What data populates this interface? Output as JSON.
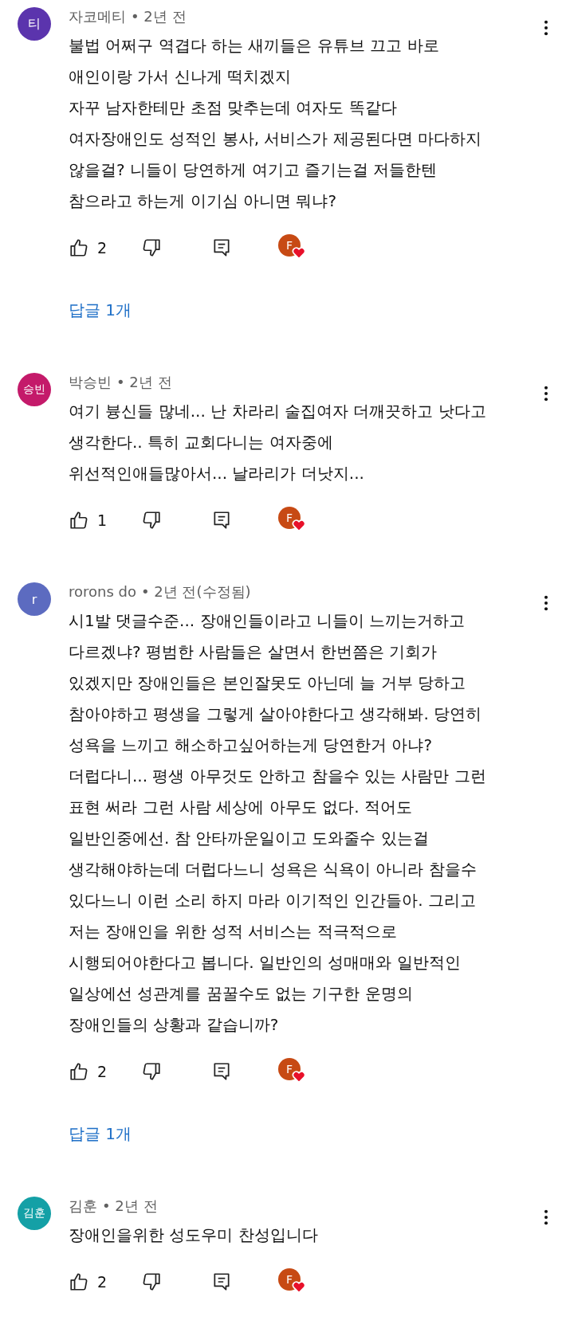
{
  "comments": [
    {
      "avatar": {
        "text": "티",
        "color": "#5b34ad"
      },
      "author": "자코메티",
      "age": "• 2년 전",
      "text": "불법 어쩌구 역겹다 하는 새끼들은 유튜브 끄고 바로\n애인이랑 가서 신나게 떡치겠지\n자꾸 남자한테만 초점 맞추는데 여자도 똑같다\n여자장애인도 성적인 봉사, 서비스가 제공된다면 마다하지\n않을걸?  니들이 당연하게 여기고 즐기는걸 저들한텐\n참으라고 하는게 이기심 아니면 뭐냐?",
      "likes": "2",
      "heart": "F",
      "replies": "답글 1개"
    },
    {
      "avatar": {
        "text": "승빈",
        "color": "#c41a6a"
      },
      "author": "박승빈",
      "age": "• 2년 전",
      "text": "여기 븅신들 많네... 난 차라리 술집여자 더깨끗하고 낫다고\n생각한다.. 특히 교회다니는 여자중에\n위선적인애들많아서... 날라리가 더낫지...",
      "likes": "1",
      "heart": "F"
    },
    {
      "avatar": {
        "text": "r",
        "color": "#5c6bc0"
      },
      "author": "rorons do",
      "age": "• 2년 전(수정됨)",
      "text": "시1발 댓글수준... 장애인들이라고 니들이 느끼는거하고\n다르겠냐? 평범한 사람들은 살면서 한번쯤은 기회가\n있겠지만 장애인들은 본인잘못도 아닌데 늘 거부 당하고\n참아야하고 평생을 그렇게 살아야한다고 생각해봐. 당연히\n성욕을 느끼고 해소하고싶어하는게 당연한거 아냐?\n더럽다니... 평생 아무것도 안하고 참을수 있는 사람만 그런\n표현 써라 그런 사람 세상에 아무도 없다. 적어도\n일반인중에선. 참 안타까운일이고 도와줄수 있는걸\n생각해야하는데 더럽다느니 성욕은 식욕이 아니라 참을수\n있다느니 이런 소리 하지 마라 이기적인 인간들아. 그리고\n저는 장애인을 위한 성적 서비스는 적극적으로\n시행되어야한다고 봅니다. 일반인의 성매매와 일반적인\n일상에선 성관계를 꿈꿀수도 없는 기구한 운명의\n장애인들의 상황과 같습니까?",
      "likes": "2",
      "heart": "F",
      "replies": "답글 1개"
    },
    {
      "avatar": {
        "text": "김훈",
        "color": "#14a0a6"
      },
      "author": "김훈",
      "age": "• 2년 전",
      "text": "장애인을위한 성도우미 찬성입니다",
      "likes": "2",
      "heart": "F"
    }
  ]
}
